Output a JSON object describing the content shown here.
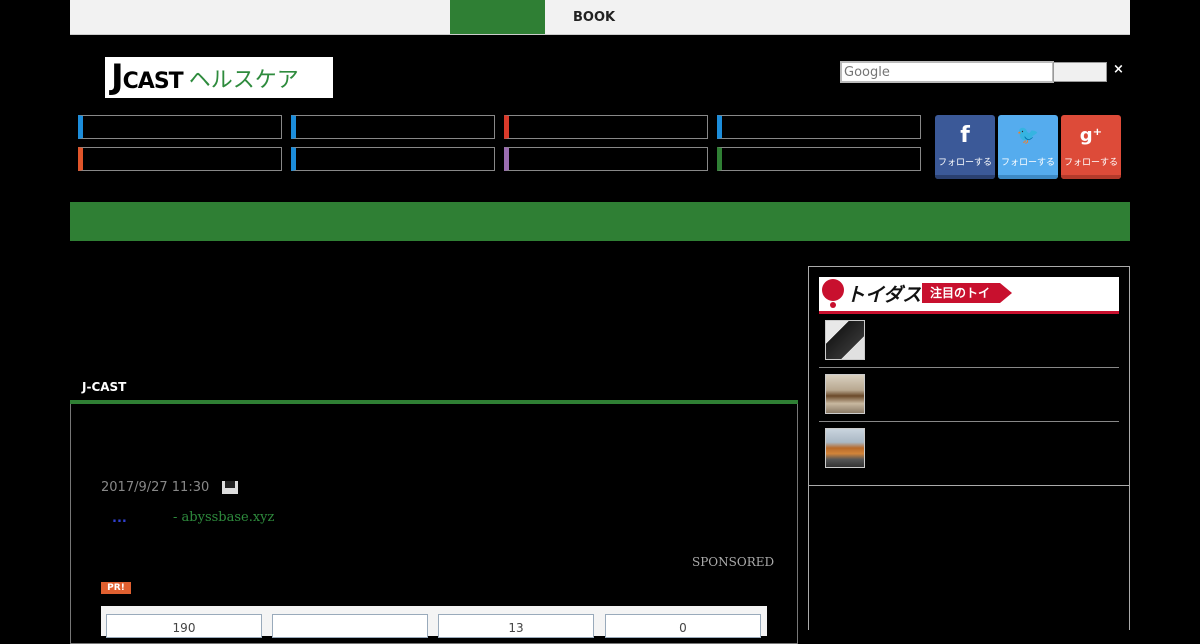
{
  "topbar": {
    "book_label": "BOOK"
  },
  "logo": {
    "j": "J",
    "cast": "CAST",
    "health": "ヘルスケア"
  },
  "search": {
    "placeholder": "Google",
    "clear": "×"
  },
  "category_colors": [
    "#1c8ddb",
    "#1c8ddb",
    "#d93a2a",
    "#1c8ddb",
    "#e0552a",
    "#1c8ddb",
    "#9a6cb0",
    "#2f7f34"
  ],
  "social": [
    {
      "icon": "facebook-icon",
      "symbol": "f",
      "label": "フォローする",
      "color": "#3b5998"
    },
    {
      "icon": "twitter-icon",
      "symbol": "🐦",
      "label": "フォローする",
      "color": "#55acee"
    },
    {
      "icon": "google-plus-icon",
      "symbol": "g⁺",
      "label": "フォローする",
      "color": "#dd4b39"
    }
  ],
  "article": {
    "section_label": "J-CAST",
    "datetime": "2017/9/27 11:30",
    "dots": "...",
    "source": "- abyssbase.xyz",
    "sponsored": "SPONSORED",
    "pr": "PR!",
    "stats": [
      "190",
      "",
      "13",
      "0"
    ]
  },
  "sidebar": {
    "toi_logo": "トイダス",
    "toi_tag": "注目のトイ"
  }
}
